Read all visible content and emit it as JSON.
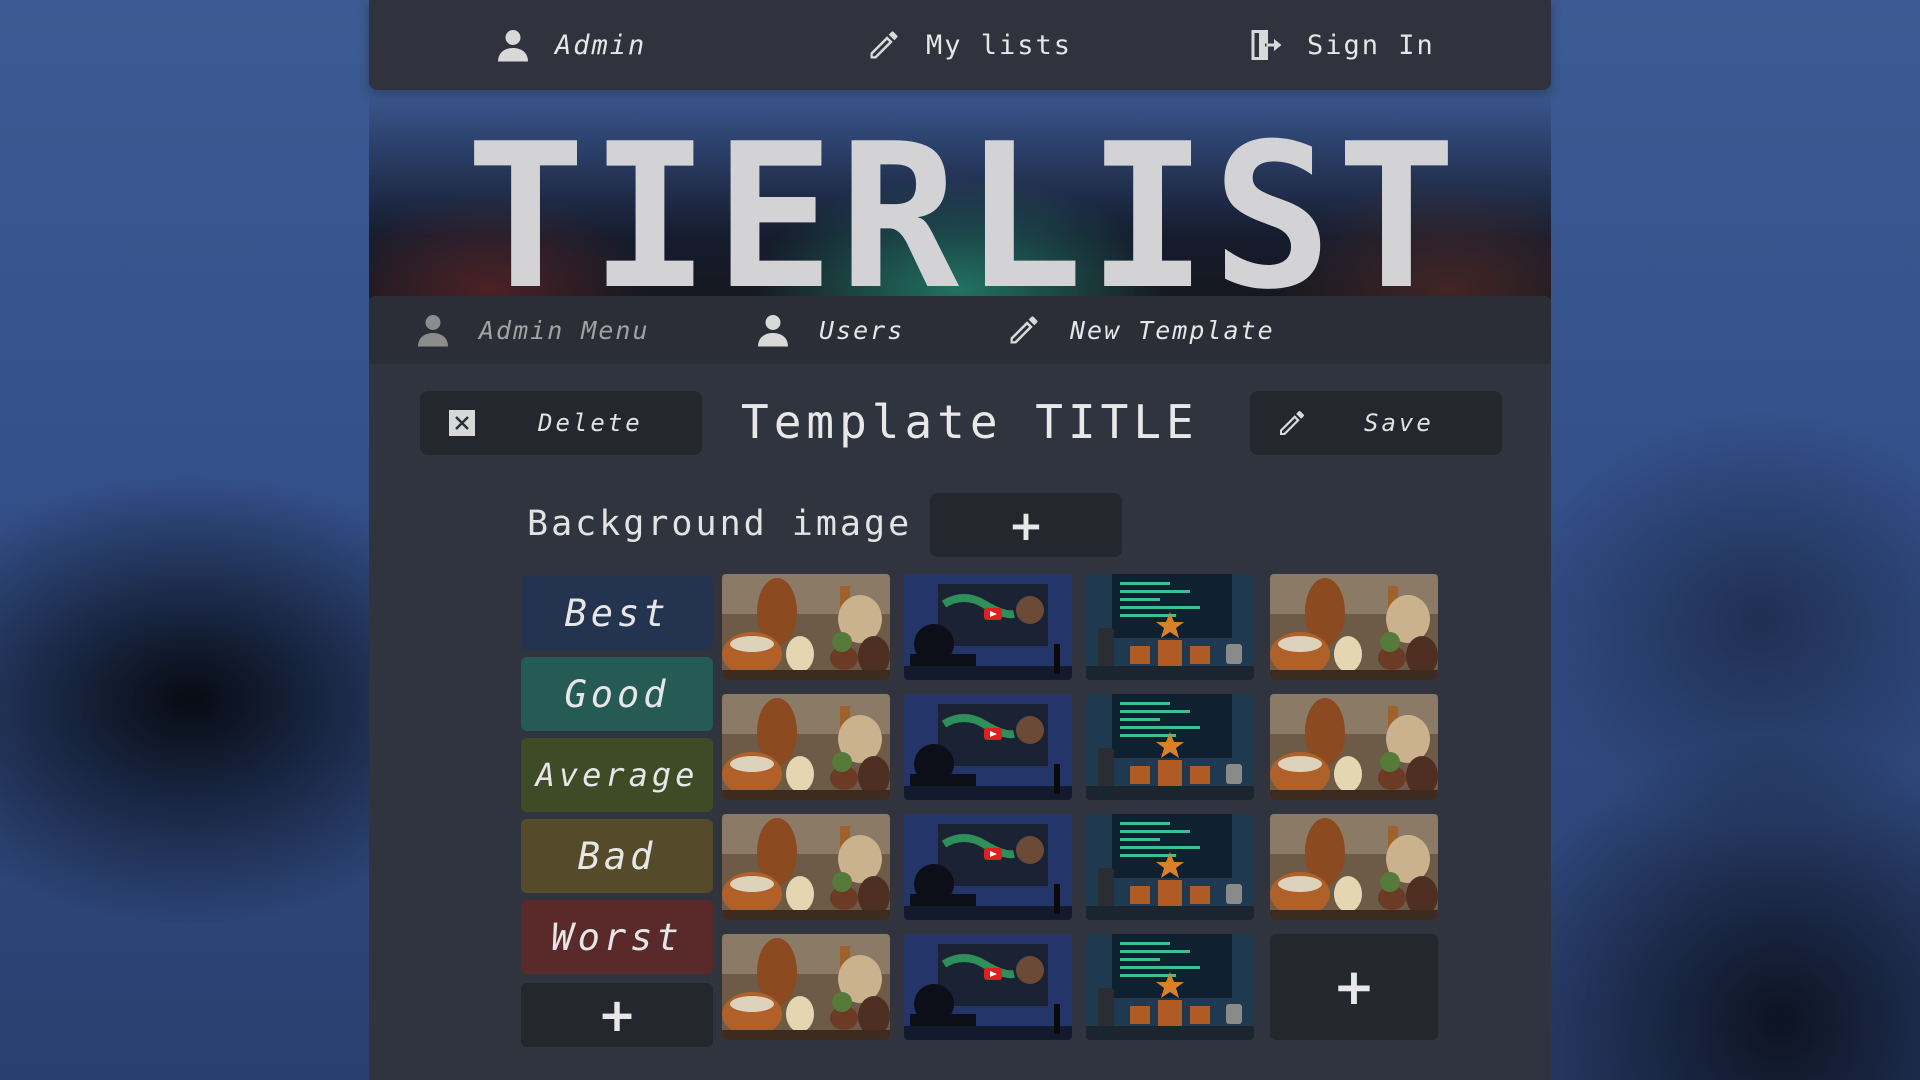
{
  "topnav": {
    "admin": "Admin",
    "my_lists": "My lists",
    "sign_in": "Sign In"
  },
  "hero": {
    "title": "TIERLIST"
  },
  "admin_nav": {
    "admin_menu": "Admin Menu",
    "users": "Users",
    "new_template": "New Template"
  },
  "editor": {
    "delete_label": "Delete",
    "template_title": "Template TITLE",
    "save_label": "Save",
    "background_label": "Background image",
    "add_symbol": "+"
  },
  "tiers": [
    {
      "label": "Best",
      "color": "#243450"
    },
    {
      "label": "Good",
      "color": "#265a55"
    },
    {
      "label": "Average",
      "color": "#3f4b27"
    },
    {
      "label": "Bad",
      "color": "#554a29"
    },
    {
      "label": "Worst",
      "color": "#5a2a2b"
    }
  ],
  "thumbnail_types": [
    "kitchen-crafts-image",
    "streamer-video-image",
    "code-monitor-image",
    "kitchen-crafts-image"
  ],
  "colors": {
    "page_bg": "#3c5a93",
    "panel": "#30343e",
    "button": "#24272e",
    "text": "#e3e3e3",
    "muted": "#9a9a9a"
  }
}
